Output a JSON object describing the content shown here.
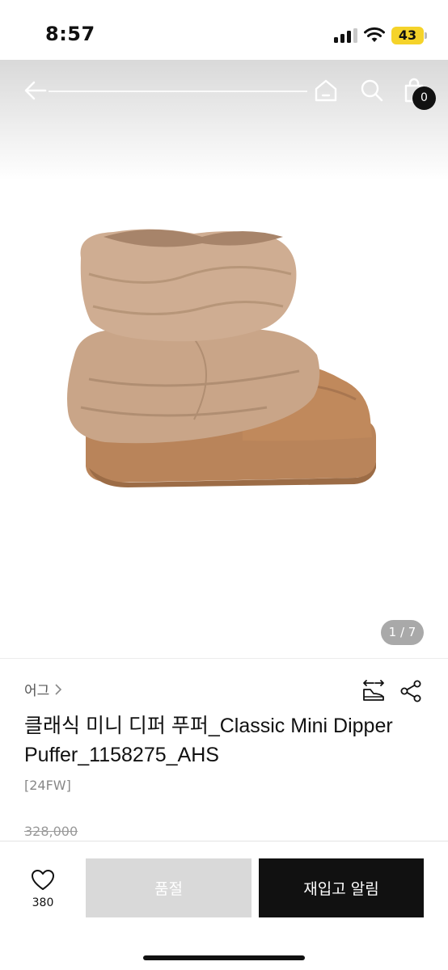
{
  "status_bar": {
    "time": "8:57",
    "battery": "43"
  },
  "header": {
    "cart_count": "0"
  },
  "gallery": {
    "indicator": "1 / 7"
  },
  "product": {
    "brand": "어그",
    "title": "클래식 미니 디퍼 푸퍼_Classic Mini Dipper Puffer_1158275_AHS",
    "season": "[24FW]",
    "original_price": "328,000"
  },
  "bottom_bar": {
    "like_count": "380",
    "soldout_label": "품절",
    "restock_label": "재입고 알림"
  },
  "icons": {
    "back": "arrow-left-icon",
    "home": "home-icon",
    "search": "search-icon",
    "cart": "shopping-bag-icon",
    "compare": "compare-shoe-icon",
    "share": "share-icon",
    "like": "heart-icon"
  },
  "colors": {
    "primary": "#111111",
    "disabled": "#d9d9d9",
    "battery": "#f5d32a"
  }
}
